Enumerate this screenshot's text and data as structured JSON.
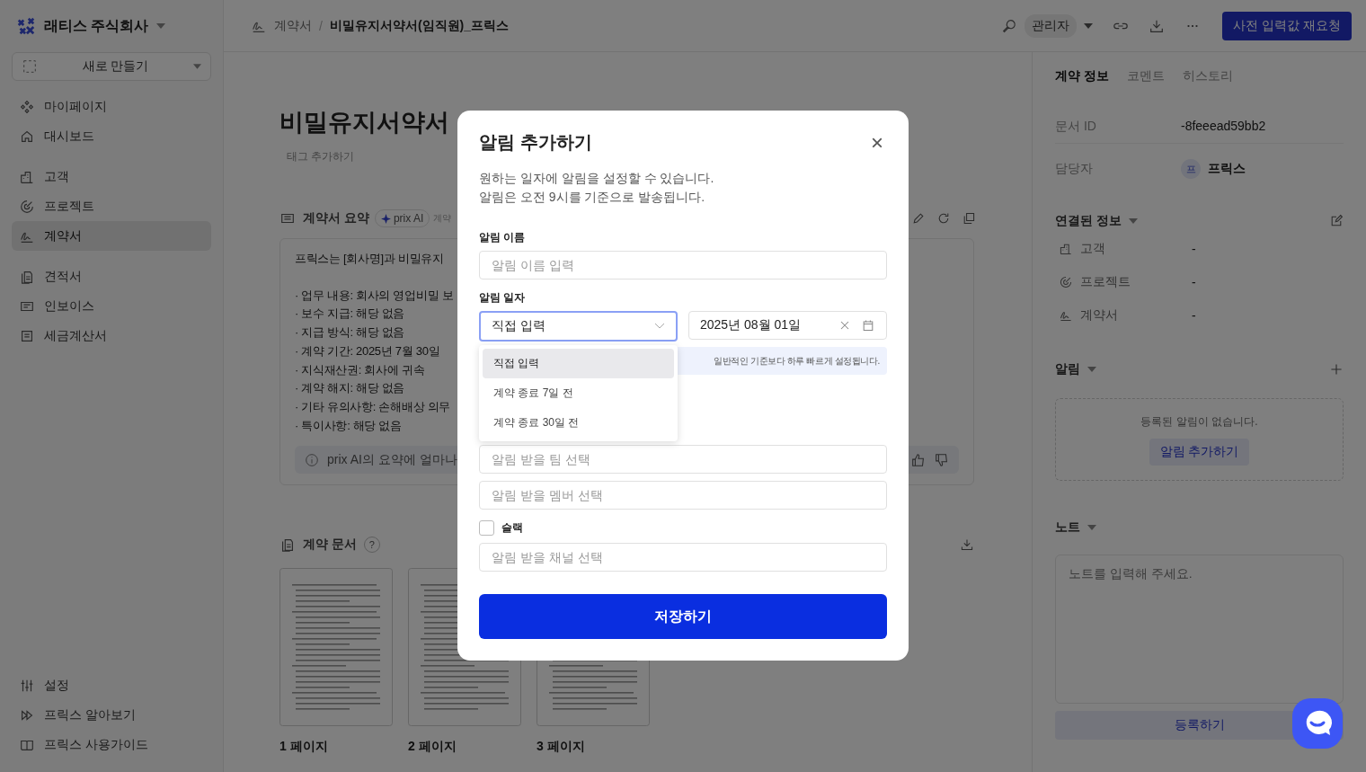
{
  "sidebar": {
    "company": "래티스 주식회사",
    "new_button": "새로 만들기",
    "nav_groups": [
      [
        {
          "label": "마이페이지",
          "selected": false
        },
        {
          "label": "대시보드",
          "selected": false
        }
      ],
      [
        {
          "label": "고객",
          "selected": false
        },
        {
          "label": "프로젝트",
          "selected": false
        },
        {
          "label": "계약서",
          "selected": true
        }
      ],
      [
        {
          "label": "견적서",
          "selected": false
        },
        {
          "label": "인보이스",
          "selected": false
        },
        {
          "label": "세금계산서",
          "selected": false
        }
      ]
    ],
    "footer_items": [
      {
        "label": "설정"
      },
      {
        "label": "프릭스 알아보기"
      },
      {
        "label": "프릭스 사용가이드"
      }
    ]
  },
  "header": {
    "breadcrumb": [
      "계약서",
      "비밀유지서약서(임직원)_프릭스"
    ],
    "separator": "/",
    "role": "관리자",
    "action_button": "사전 입력값 재요청"
  },
  "main": {
    "title": "비밀유지서약서",
    "tag_link": "태그 추가하기",
    "summary": {
      "heading": "계약서 요약",
      "ai_chip": "prix AI",
      "chip_note": "계약",
      "intro": "프릭스는 [회사명]과 비밀유지",
      "items": [
        "· 업무 내용: 회사의 영업비밀 보",
        "· 보수 지급: 해당 없음",
        "· 지급 방식: 해당 없음",
        "· 계약 기간: 2025년 7월 30일",
        "· 지식재산권: 회사에 귀속",
        "· 계약 해지: 해당 없음",
        "· 기타 유의사항: 손해배상 의무",
        "· 특이사항: 해당 없음"
      ],
      "feedback": "prix AI의 요약에 얼마나"
    },
    "documents": {
      "heading": "계약 문서",
      "help": "?",
      "pages": [
        {
          "label": "1 페이지"
        },
        {
          "label": "2 페이지"
        },
        {
          "label": "3 페이지"
        }
      ]
    }
  },
  "modal": {
    "title": "알림 추가하기",
    "close": "×",
    "description": [
      "원하는 일자에 알림을 설정할 수 있습니다.",
      "알림은 오전 9시를 기준으로 발송됩니다."
    ],
    "name_label": "알림 이름",
    "name_placeholder": "알림 이름 입력",
    "date_label": "알림 일자",
    "date_mode": "직접 입력",
    "date_value": "2025년 08월 01일",
    "notice": "일반적인 기준보다 하루 빠르게 설정됩니다.",
    "date_options": [
      {
        "label": "직접 입력",
        "selected": true
      },
      {
        "label": "계약 종료 7일 전",
        "selected": false
      },
      {
        "label": "계약 종료 30일 전",
        "selected": false
      }
    ],
    "team_placeholder": "알림 받을 팀 선택",
    "member_placeholder": "알림 받을 멤버 선택",
    "slack": {
      "label": "슬랙",
      "checked": false
    },
    "channel_placeholder": "알림 받을 채널 선택",
    "save_button": "저장하기"
  },
  "right_panel": {
    "tabs": [
      {
        "label": "계약 정보",
        "selected": true
      },
      {
        "label": "코멘트",
        "selected": false
      },
      {
        "label": "히스토리",
        "selected": false
      }
    ],
    "doc_id": {
      "label": "문서 ID",
      "value": "-8feeead59bb2"
    },
    "owner": {
      "label": "담당자",
      "avatar": "프",
      "value": "프릭스"
    },
    "linked": {
      "heading": "연결된 정보",
      "rows": [
        {
          "label": "고객",
          "value": "-"
        },
        {
          "label": "프로젝트",
          "value": "-"
        },
        {
          "label": "계약서",
          "value": "-"
        }
      ]
    },
    "alerts": {
      "heading": "알림",
      "empty": "등록된 알림이 없습니다.",
      "add_button": "알림 추가하기"
    },
    "notes": {
      "heading": "노트",
      "placeholder": "노트를 입력해 주세요.",
      "submit": "등록하기"
    }
  }
}
